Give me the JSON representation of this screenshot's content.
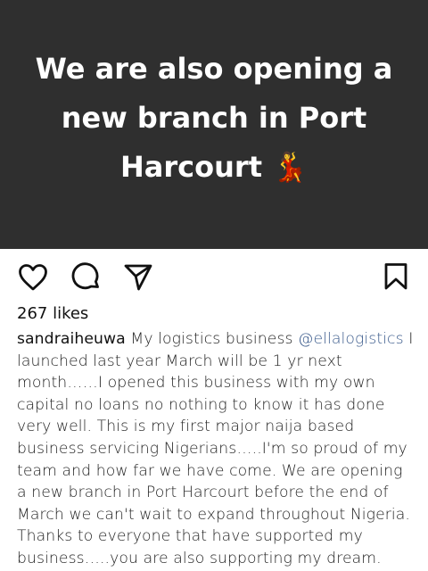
{
  "post": {
    "image_text": "We are also opening a new branch in Port Harcourt 💃",
    "likes": "267 likes",
    "username": "sandraiheuwa",
    "caption_before_mention": " My logistics business ",
    "mention": "@ellalogistics",
    "caption_after_mention": " I launched last year March will be 1 yr next month……I opened this business with my own capital no loans no nothing to know it has done very well. This is my first major naija based business servicing Nigerians…..I'm so proud of my team and how far we have come. We are opening a new branch in Port Harcourt before the end of March we can't wait to expand throughout Nigeria. Thanks to everyone that have supported my business…..you are also supporting my dream. Thank you 🙏"
  },
  "icons": {
    "like": "heart-icon",
    "comment": "comment-bubble-icon",
    "share": "paper-plane-icon",
    "save": "bookmark-icon"
  },
  "colors": {
    "image_background": "#2f2f2f",
    "mention": "#3b5b8c"
  }
}
